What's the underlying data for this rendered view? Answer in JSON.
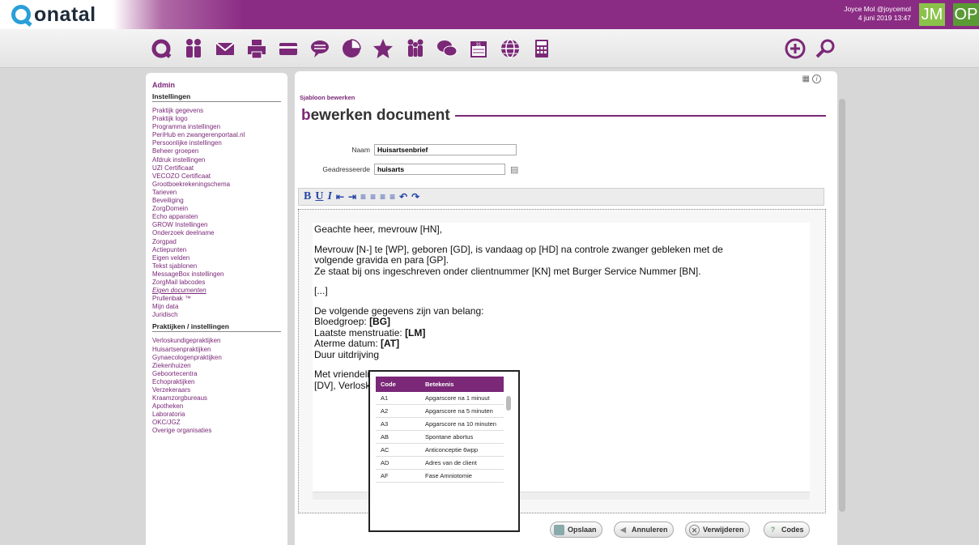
{
  "app": {
    "logo_text": "onatal"
  },
  "user": {
    "line1": "Joyce Mol @joycemol",
    "line2": "4 juni 2019 13:47",
    "avatar1": "JM",
    "avatar2": "OP"
  },
  "toolbar_icons": [
    "home-q-icon",
    "people-icon",
    "mail-icon",
    "print-icon",
    "card-icon",
    "chat-icon",
    "pie-chart-icon",
    "star-icon",
    "group-icon",
    "messages-icon",
    "calendar-icon",
    "globe-icon",
    "calculator-icon",
    "add-icon",
    "search-icon"
  ],
  "sidebar": {
    "admin": "Admin",
    "section1": "Instellingen",
    "items1": [
      "Praktijk gegevens",
      "Praktijk logo",
      "Programma instellingen",
      "PeriHub en zwangerenportaal.nl",
      "Persoonlijke instellingen",
      "Beheer groepen",
      "Afdruk instellingen",
      "UZI Certificaat",
      "VECOZO Certificaat",
      "Grootboekrekeningschema",
      "Tarieven",
      "Beveiliging",
      "ZorgDomein",
      "Echo apparaten",
      "GROW Instellingen",
      "Onderzoek deelname",
      "Zorgpad",
      "Actiepunten",
      "Eigen velden",
      "Tekst sjablonen",
      "MessageBox instellingen",
      "ZorgMail labcodes",
      "Eigen documenten",
      "Prullenbak ™",
      "Mijn data",
      "Juridisch"
    ],
    "section2": "Praktijken / instellingen",
    "items2": [
      "Verloskundigepraktijken",
      "Huisartsenpraktijken",
      "Gynaecologenpraktijken",
      "Ziekenhuizen",
      "Geboortecentra",
      "Echopraktijken",
      "Verzekeraars",
      "Kraamzorgbureaus",
      "Apotheken",
      "Laboratoria",
      "OKC/JGZ",
      "Overige organisaties"
    ]
  },
  "main": {
    "breadcrumb": "Sjabloon bewerken",
    "title_first": "b",
    "title_rest": "ewerken document",
    "naam_label": "Naam",
    "naam_value": "Huisartsenbrief",
    "geadresseerde_label": "Geadresseerde",
    "geadresseerde_value": "huisarts"
  },
  "editor": {
    "line1": "Geachte heer, mevrouw [HN],",
    "line2": "Mevrouw [N-] te [WP], geboren [GD], is vandaag op [HD] na controle zwanger gebleken met de",
    "line3": "volgende gravida en para [GP].",
    "line4": "Ze staat bij ons ingeschreven onder clientnummer [KN] met Burger Service Nummer [BN].",
    "line5": "[...]",
    "line6": "De volgende gegevens zijn van belang:",
    "line7a": "Bloedgroep: ",
    "line7b": "[BG]",
    "line8a": "Laatste menstruatie: ",
    "line8b": "[LM]",
    "line9a": "Aterme datum: ",
    "line9b": "[AT]",
    "line10": "Duur uitdrijving",
    "line11": "Met vriendelijke",
    "line12": "[DV], Verloskundige"
  },
  "codes_popup": {
    "col_code": "Code",
    "col_desc": "Betekenis",
    "rows": [
      {
        "code": "A1",
        "desc": "Apgarscore na 1 minuut"
      },
      {
        "code": "A2",
        "desc": "Apgarscore na 5 minuten"
      },
      {
        "code": "A3",
        "desc": "Apgarscore na 10 minuten"
      },
      {
        "code": "AB",
        "desc": "Spontane abortus"
      },
      {
        "code": "AC",
        "desc": "Anticonceptie 6wpp"
      },
      {
        "code": "AD",
        "desc": "Adres van de client"
      },
      {
        "code": "AF",
        "desc": "Fase Amniotomie"
      }
    ]
  },
  "buttons": {
    "save": "Opslaan",
    "cancel": "Annuleren",
    "delete": "Verwijderen",
    "codes": "Codes"
  },
  "colors": {
    "brand": "#7a2877",
    "accent_blue": "#2a9fd8",
    "avatar_jm": "#8bc34a",
    "avatar_op": "#5a9a35"
  }
}
